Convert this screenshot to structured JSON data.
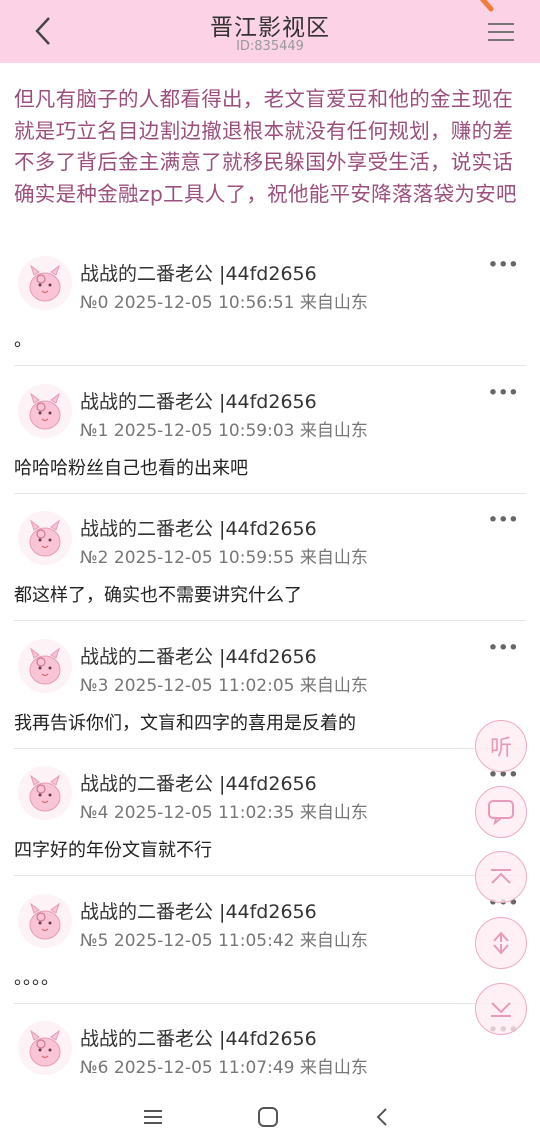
{
  "header": {
    "title": "晋江影视区",
    "id_text": "ID:835449"
  },
  "topic": {
    "text": "但凡有脑子的人都看得出，老文盲爱豆和他的金主现在就是巧立名目边割边撤退根本就没有任何规划，赚的差不多了背后金主满意了就移民躲国外享受生活，说实话确实是种金融zp工具人了，祝他能平安降落落袋为安吧"
  },
  "posts": [
    {
      "author": "战战的二番老公 |44fd2656",
      "meta": "№0 2025-12-05 10:56:51 来自山东",
      "content": "。"
    },
    {
      "author": "战战的二番老公 |44fd2656",
      "meta": "№1 2025-12-05 10:59:03 来自山东",
      "content": "哈哈哈粉丝自己也看的出来吧"
    },
    {
      "author": "战战的二番老公 |44fd2656",
      "meta": "№2 2025-12-05 10:59:55 来自山东",
      "content": "都这样了，确实也不需要讲究什么了"
    },
    {
      "author": "战战的二番老公 |44fd2656",
      "meta": "№3 2025-12-05 11:02:05 来自山东",
      "content": "我再告诉你们，文盲和四字的喜用是反着的"
    },
    {
      "author": "战战的二番老公 |44fd2656",
      "meta": "№4 2025-12-05 11:02:35 来自山东",
      "content": "四字好的年份文盲就不行"
    },
    {
      "author": "战战的二番老公 |44fd2656",
      "meta": "№5 2025-12-05 11:05:42 来自山东",
      "content": "。。。。"
    },
    {
      "author": "战战的二番老公 |44fd2656",
      "meta": "№6 2025-12-05 11:07:49 来自山东",
      "content": ""
    }
  ],
  "ui": {
    "more_glyph": "•••",
    "listen_label": "听",
    "icons": {
      "back": "chevron-left-icon",
      "menu": "hamburger-menu-icon",
      "more": "more-dots-icon",
      "comment": "comment-bubble-icon",
      "to_top": "scroll-top-icon",
      "refresh": "refresh-icon",
      "to_bottom": "scroll-bottom-icon",
      "nav_menu": "system-menu-icon",
      "nav_home": "system-home-icon",
      "nav_back": "system-back-icon"
    }
  },
  "colors": {
    "header_bg": "#fcd2e6",
    "topic_text": "#9c4f7d",
    "float_accent": "#e89ab9"
  }
}
